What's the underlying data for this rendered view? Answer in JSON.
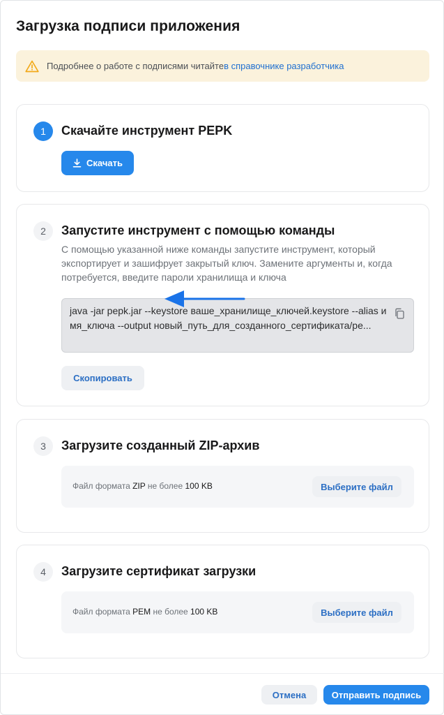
{
  "dialog": {
    "title": "Загрузка подписи приложения"
  },
  "notice": {
    "text": "Подробнее о работе с подписями читайте ",
    "link": "в справочнике разработчика"
  },
  "steps": [
    {
      "number": "1",
      "title": "Скачайте инструмент PEPK",
      "button": "Скачать"
    },
    {
      "number": "2",
      "title": "Запустите инструмент с помощью команды",
      "description": "С помощью указанной ниже команды запустите инструмент, который экспортирует и зашифрует закрытый ключ. Замените аргументы и, когда потребуется, введите пароли хранилища и ключа",
      "command": "java -jar pepk.jar --keystore ваше_хранилище_ключей.keystore --alias имя_ключа --output новый_путь_для_созданного_сертификата/pe...",
      "button": "Скопировать"
    },
    {
      "number": "3",
      "title": "Загрузите созданный ZIP-архив",
      "file_prefix": "Файл формата ",
      "file_format": "ZIP",
      "file_middle": " не более ",
      "file_size": "100 KB",
      "button": "Выберите файл"
    },
    {
      "number": "4",
      "title": "Загрузите сертификат загрузки",
      "file_prefix": "Файл формата ",
      "file_format": "PEM",
      "file_middle": " не более ",
      "file_size": "100 KB",
      "button": "Выберите файл"
    }
  ],
  "footer": {
    "cancel": "Отмена",
    "submit": "Отправить подпись"
  },
  "colors": {
    "accent": "#2688eb",
    "notice_bg": "#fbf2dc",
    "warning": "#f2a918"
  },
  "icons": {
    "notice": "warning-triangle-icon",
    "download": "download-icon",
    "copy": "copy-icon",
    "annotation": "arrow-left-icon"
  }
}
